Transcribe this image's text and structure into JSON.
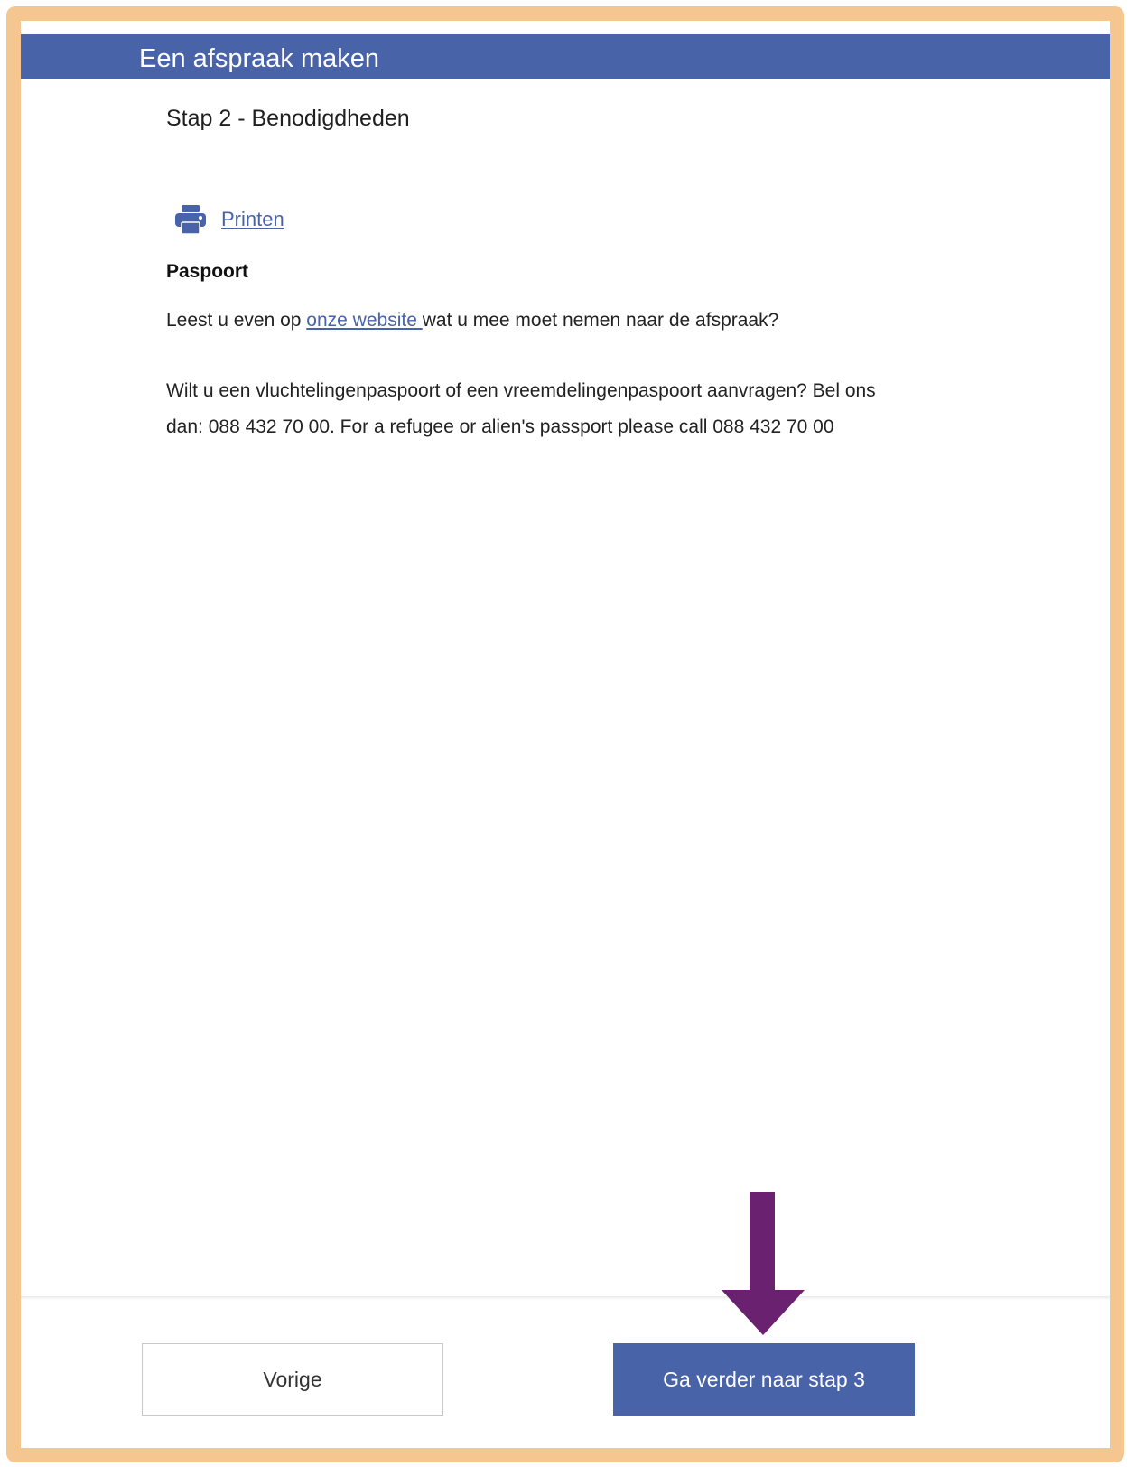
{
  "header": {
    "title": "Een afspraak maken"
  },
  "step": {
    "title": "Stap 2 - Benodigdheden"
  },
  "print": {
    "label": "Printen",
    "icon": "printer-icon"
  },
  "section": {
    "heading": "Paspoort",
    "para1_before": "Leest u even op ",
    "para1_link": "onze website ",
    "para1_after": "wat u mee moet nemen naar de afspraak?",
    "para2": "Wilt u een vluchtelingenpaspoort of een vreemdelingenpaspoort aanvragen? Bel ons dan: 088 432 70 00. For a refugee or alien's passport please call 088 432 70 00"
  },
  "footer": {
    "prev_label": "Vorige",
    "next_label": "Ga verder naar stap 3"
  },
  "colors": {
    "primary": "#4863a8",
    "frame": "#f5c690",
    "arrow": "#6a2270"
  }
}
